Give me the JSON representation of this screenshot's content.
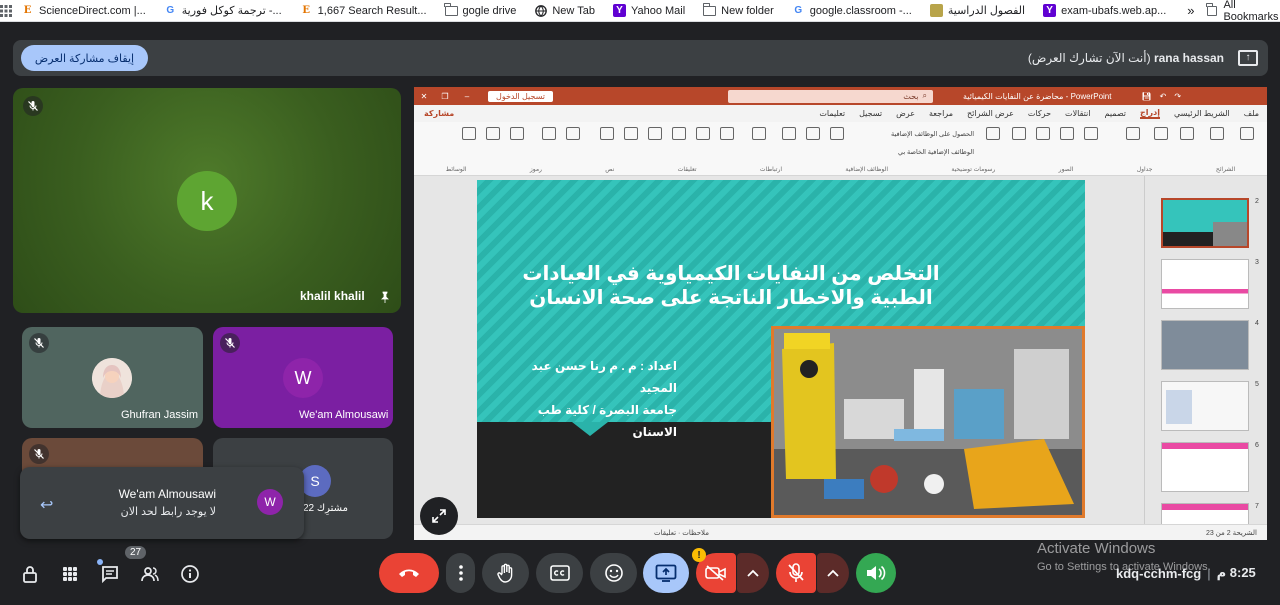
{
  "bookmarks": [
    {
      "label": "ScienceDirect.com |...",
      "icon": "elsevier-icon"
    },
    {
      "label": "ترجمة كوكل فورية -...",
      "icon": "google-icon"
    },
    {
      "label": "1,667 Search Result...",
      "icon": "elsevier-icon"
    },
    {
      "label": "gogle drive",
      "icon": "folder-icon"
    },
    {
      "label": "New Tab",
      "icon": "globe-icon"
    },
    {
      "label": "Yahoo Mail",
      "icon": "yahoo-icon"
    },
    {
      "label": "New folder",
      "icon": "folder-icon"
    },
    {
      "label": "google.classroom -...",
      "icon": "google-icon"
    },
    {
      "label": "الفصول الدراسية",
      "icon": "classroom-icon"
    },
    {
      "label": "exam-ubafs.web.ap...",
      "icon": "yahoo-icon"
    }
  ],
  "all_bookmarks": "All Bookmarks",
  "banner": {
    "stop_label": "إيقاف مشاركة العرض",
    "presenter": "rana hassan",
    "presenter_note": "(أنت الآن تشارك العرض)"
  },
  "participants": {
    "main": {
      "name": "khalil khalil",
      "initial": "k"
    },
    "p2": {
      "name": "Ghufran Jassim"
    },
    "p3": {
      "name": "We'am Almousawi",
      "initial": "W"
    },
    "p5": {
      "initial": "S",
      "count_label": "22 مشترِك"
    }
  },
  "notification": {
    "name": "We'am Almousawi",
    "message": "لا يوجد رابط لحد الان",
    "initial": "W"
  },
  "ppt": {
    "title": "محاضرة عن النفايات الكيميائية - PowerPoint",
    "search": "بحث",
    "signin": "تسجيل الدخول",
    "share": "مشاركة",
    "tabs": [
      "ملف",
      "الشريط الرئيسي",
      "إدراج",
      "تصميم",
      "انتقالات",
      "حركات",
      "عرض الشرائح",
      "مراجعة",
      "عرض",
      "تسجيل",
      "تعليمات"
    ],
    "active_tab": "إدراج",
    "ribbon_groups": [
      "الشرائح",
      "جداول",
      "الصور",
      "رسومات توضيحية",
      "الوظائف الإضافية",
      "ارتباطات",
      "تعليقات",
      "نص",
      "رموز",
      "الوسائط"
    ],
    "addins": [
      "الحصول على الوظائف الإضافية",
      "الوظائف الإضافية الخاصة بي"
    ],
    "slide_title_line1": "التخلص من النفايات الكيمياوية في العيادات",
    "slide_title_line2": "الطبية والاخطار الناتجة على صحة الانسان",
    "slide_author_line1": "اعداد : م . م رنا حسن عبد المجيد",
    "slide_author_line2": "جامعة البصرة / كلية طب الاسنان",
    "thumb_numbers": [
      "2",
      "3",
      "4",
      "5",
      "6",
      "7"
    ],
    "status_left": "ملاحظات",
    "status_mid": "تعليقات",
    "status_right": "الشريحة 2 من 23"
  },
  "controls": {
    "hand_count": "27"
  },
  "activate": {
    "line1": "Activate Windows",
    "line2": "Go to Settings to activate Windows."
  },
  "meeting": {
    "code": "kdq-cchm-fcg",
    "time": "8:25 م"
  }
}
